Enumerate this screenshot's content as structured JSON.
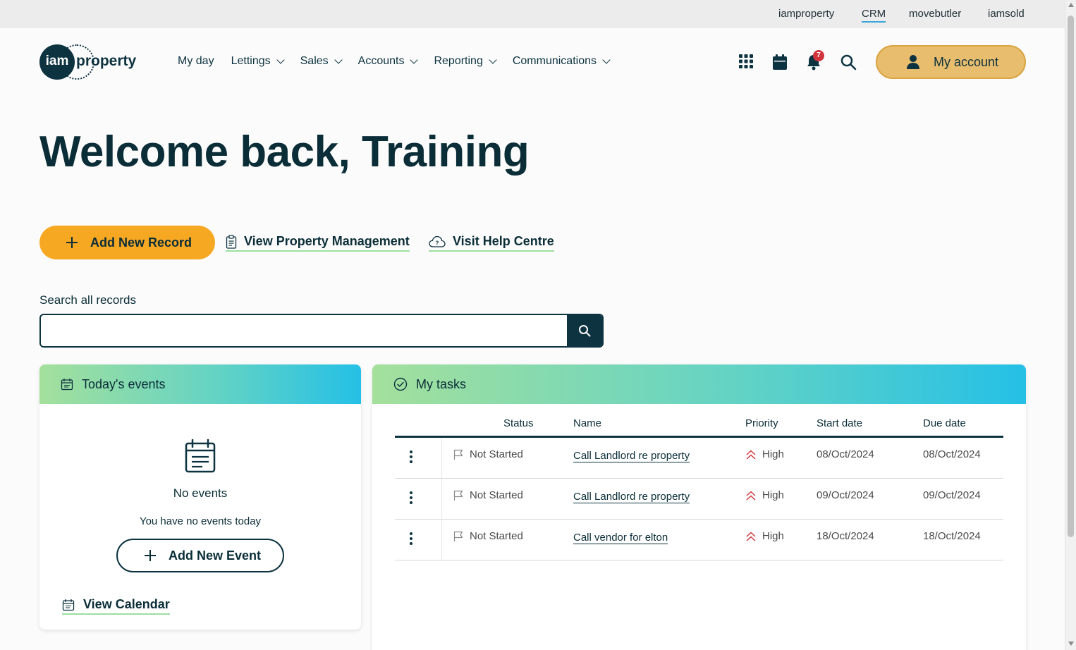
{
  "topbar": {
    "links": [
      "iamproperty",
      "CRM",
      "movebutler",
      "iamsold"
    ],
    "active": "CRM"
  },
  "logo": {
    "mark": "iam",
    "word": "property"
  },
  "nav": {
    "items": [
      "My day",
      "Lettings",
      "Sales",
      "Accounts",
      "Reporting",
      "Communications"
    ]
  },
  "header": {
    "notification_count": "7",
    "account_label": "My account"
  },
  "page": {
    "title": "Welcome back, Training"
  },
  "actions": {
    "add_record": "Add New Record",
    "view_property_management": "View Property Management",
    "visit_help_centre": "Visit Help Centre"
  },
  "search": {
    "label": "Search all records",
    "value": "",
    "placeholder": ""
  },
  "events": {
    "title": "Today's events",
    "empty_title": "No events",
    "empty_text": "You have no events today",
    "add_event": "Add New Event",
    "view_calendar": "View Calendar"
  },
  "tasks": {
    "title": "My tasks",
    "columns": {
      "status": "Status",
      "name": "Name",
      "priority": "Priority",
      "start": "Start date",
      "due": "Due date"
    },
    "rows": [
      {
        "status": "Not Started",
        "name": "Call Landlord re property",
        "priority": "High",
        "start": "08/Oct/2024",
        "due": "08/Oct/2024"
      },
      {
        "status": "Not Started",
        "name": "Call Landlord re property",
        "priority": "High",
        "start": "09/Oct/2024",
        "due": "09/Oct/2024"
      },
      {
        "status": "Not Started",
        "name": "Call vendor for elton",
        "priority": "High",
        "start": "18/Oct/2024",
        "due": "18/Oct/2024"
      }
    ]
  },
  "colors": {
    "brand_dark": "#0d3340",
    "accent_orange": "#f7a823",
    "account_gold": "#e8bd6d",
    "badge_red": "#d1343c",
    "link_underline": "#9be0a0",
    "priority_high": "#d1343c"
  },
  "icons": [
    "apps-grid-icon",
    "calendar-icon",
    "bell-icon",
    "search-icon",
    "person-icon",
    "plus-icon",
    "clipboard-icon",
    "cloud-help-icon",
    "check-circle-icon",
    "flag-icon",
    "double-chevron-up-icon",
    "kebab-menu-icon"
  ]
}
